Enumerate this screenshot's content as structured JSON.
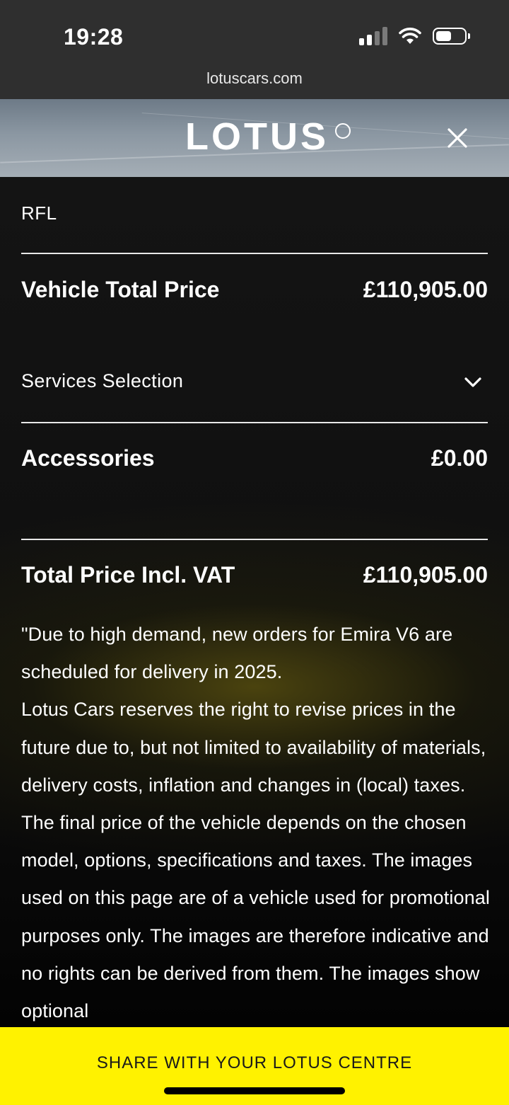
{
  "status_bar": {
    "time": "19:28",
    "url": "lotuscars.com"
  },
  "header": {
    "brand": "LOTUS"
  },
  "summary": {
    "rfl_label": "RFL",
    "vehicle_total_label": "Vehicle Total Price",
    "vehicle_total_value": "£110,905.00",
    "services_label": "Services Selection",
    "accessories_label": "Accessories",
    "accessories_value": "£0.00",
    "total_incl_vat_label": "Total Price Incl. VAT",
    "total_incl_vat_value": "£110,905.00"
  },
  "disclaimer": "\"Due to high demand, new orders for Emira V6 are scheduled for delivery in 2025.\nLotus Cars reserves the right to revise prices in the future due to, but not limited to availability of materials, delivery costs, inflation and changes in (local) taxes. The final price of the vehicle depends on the chosen model, options, specifications and taxes. The images used on this page are of a vehicle used for promotional purposes only. The images are therefore indicative and no rights can be derived from them. The images show optional",
  "cta": {
    "label": "SHARE WITH YOUR LOTUS CENTRE"
  },
  "colors": {
    "cta_background": "#fff200",
    "page_background": "#0d0d0d",
    "status_bar_background": "#2f2f2f"
  },
  "icons": [
    "signal-icon",
    "wifi-icon",
    "battery-icon",
    "close-icon",
    "chevron-down-icon"
  ]
}
